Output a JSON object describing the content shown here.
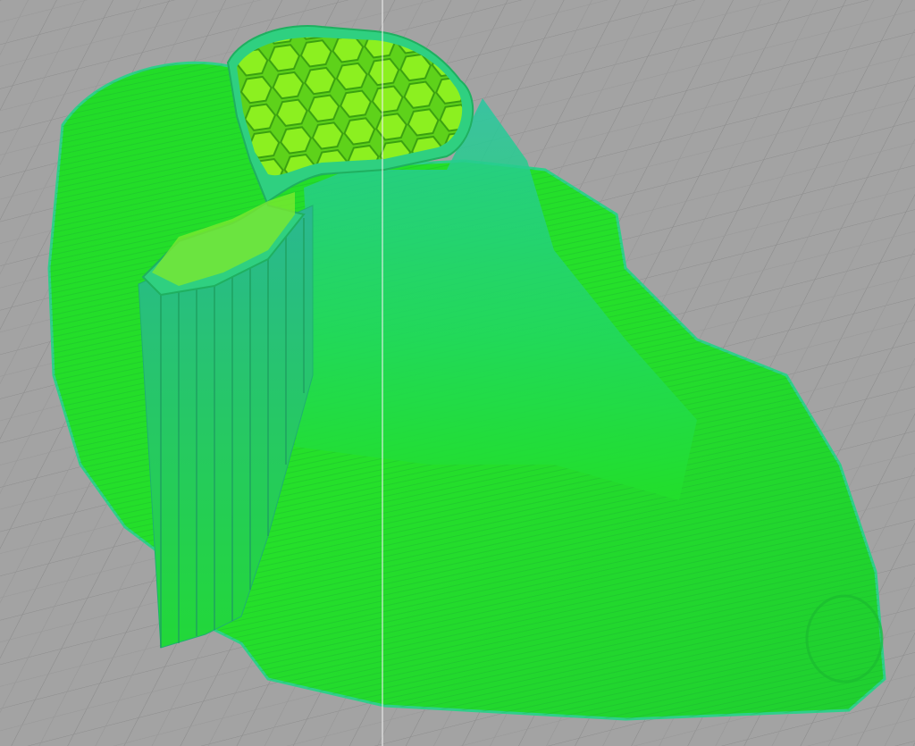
{
  "viewport": {
    "background_color": "#a3a3a3",
    "grid_color": "#8c8c8c",
    "model_color": "#22e022",
    "model_shade_color": "#1fc85a",
    "wall_color": "#2fcf8a",
    "infill_color": "#7ef01a",
    "cursor_line_color": "#f0f0f0"
  }
}
